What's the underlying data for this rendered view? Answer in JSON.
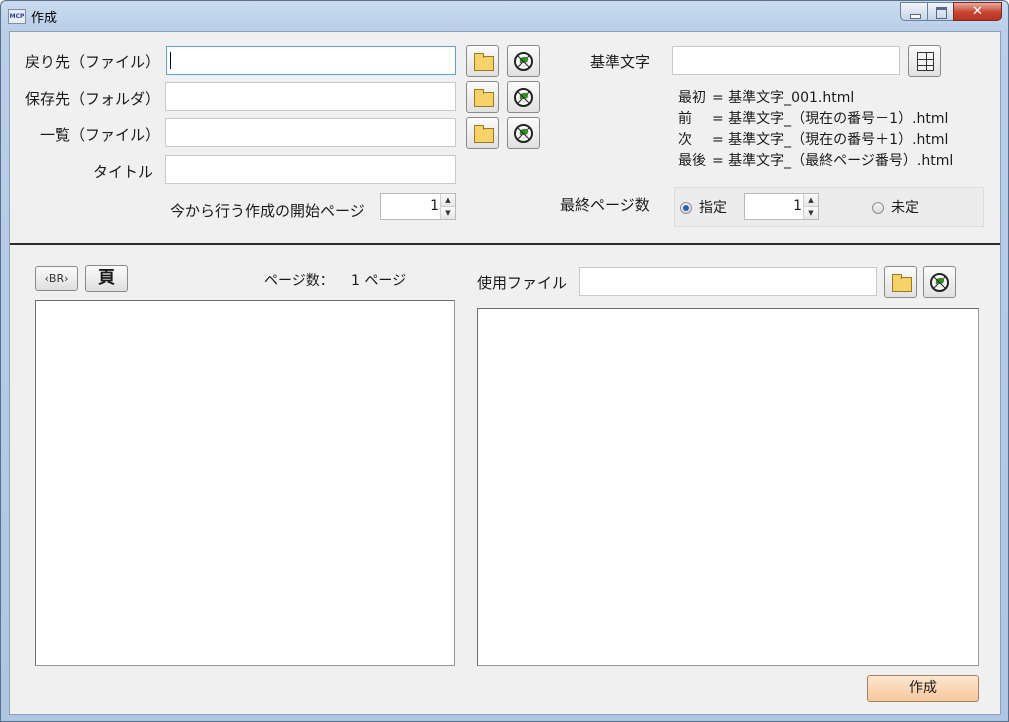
{
  "window": {
    "title": "作成",
    "app_icon": "MCP",
    "close_glyph": "✕"
  },
  "top": {
    "return_file_label": "戻り先（ファイル）",
    "save_folder_label": "保存先（フォルダ）",
    "list_file_label": "一覧（ファイル）",
    "title_label": "タイトル",
    "start_page_label": "今から行う作成の開始ページ",
    "start_page_value": "1",
    "base_text_label": "基準文字",
    "info": [
      {
        "key": "最初",
        "value": "=  基準文字_001.html"
      },
      {
        "key": "前",
        "value": "=  基準文字_（現在の番号－1）.html"
      },
      {
        "key": "次",
        "value": "=  基準文字_（現在の番号＋1）.html"
      },
      {
        "key": "最後",
        "value": "=  基準文字_（最終ページ番号）.html"
      }
    ],
    "last_page_label": "最終ページ数",
    "specified_label": "指定",
    "specified_value": "1",
    "undetermined_label": "未定",
    "selected_option": "指定"
  },
  "bottom": {
    "br_button": "‹BR›",
    "page_button": "頁",
    "page_count_label": "ページ数：",
    "page_count_value": "1 ページ",
    "use_file_label": "使用ファイル",
    "create_button": "作成"
  },
  "icons": {
    "folder": "folder-icon",
    "browser": "globe-icon",
    "grid": "table-icon"
  }
}
